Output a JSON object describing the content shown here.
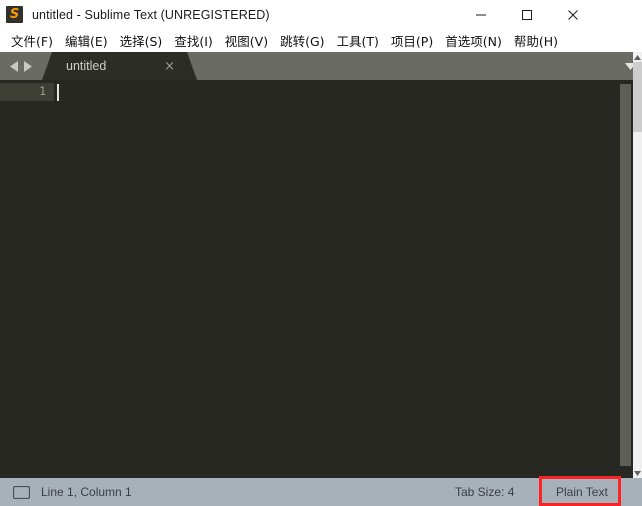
{
  "window": {
    "title": "untitled - Sublime Text (UNREGISTERED)",
    "logo_glyph": "S",
    "logo_name": "sublime-text-logo",
    "controls": {
      "minimize_label": "—",
      "maximize_label": "□",
      "close_label": "✕"
    }
  },
  "menu": {
    "items": [
      {
        "label": "文件(F)"
      },
      {
        "label": "编辑(E)"
      },
      {
        "label": "选择(S)"
      },
      {
        "label": "查找(I)"
      },
      {
        "label": "视图(V)"
      },
      {
        "label": "跳转(G)"
      },
      {
        "label": "工具(T)"
      },
      {
        "label": "项目(P)"
      },
      {
        "label": "首选项(N)"
      },
      {
        "label": "帮助(H)"
      }
    ]
  },
  "tab_bar": {
    "tabs": [
      {
        "label": "untitled",
        "close_label": "×",
        "active": true
      }
    ],
    "dropdown_icon": "chevron-down-icon"
  },
  "editor": {
    "line_numbers": [
      "1"
    ],
    "lines": [
      ""
    ],
    "caret_line": 1,
    "caret_column": 1
  },
  "status_bar": {
    "position_text": "Line 1, Column 1",
    "tab_size_text": "Tab Size: 4",
    "syntax_text": "Plain Text"
  },
  "annotation": {
    "color": "#fb2323",
    "target": "Plain Text"
  },
  "colors": {
    "editor_background": "#272822",
    "gutter_active_line": "#3e3f34",
    "tab_bar_background": "#6b6b66",
    "active_tab_background": "#2d2d28",
    "status_bar_background": "#a8b0ba",
    "logo_accent": "#ff9800",
    "annotation_red": "#fb2323"
  }
}
